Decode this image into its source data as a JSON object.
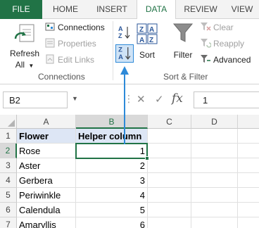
{
  "tabs": [
    "FILE",
    "HOME",
    "INSERT",
    "DATA",
    "REVIEW",
    "VIEW"
  ],
  "ribbon": {
    "connections_group": {
      "refresh_label": "Refresh",
      "refresh_sub": "All",
      "connections": "Connections",
      "properties": "Properties",
      "edit_links": "Edit Links",
      "group_label": "Connections"
    },
    "sort_filter_group": {
      "sort_label": "Sort",
      "filter_label": "Filter",
      "clear": "Clear",
      "reapply": "Reapply",
      "advanced": "Advanced",
      "group_label": "Sort & Filter"
    }
  },
  "formula_bar": {
    "name_box": "B2",
    "formula_value": "1"
  },
  "grid": {
    "columns": [
      "A",
      "B",
      "C",
      "D"
    ],
    "rows": [
      "1",
      "2",
      "3",
      "4",
      "5",
      "6",
      "7"
    ],
    "header": [
      "Flower",
      "Helper column"
    ],
    "data": [
      [
        "Rose",
        "1"
      ],
      [
        "Aster",
        "2"
      ],
      [
        "Gerbera",
        "3"
      ],
      [
        "Periwinkle",
        "4"
      ],
      [
        "Calendula",
        "5"
      ],
      [
        "Amaryllis",
        "6"
      ]
    ]
  },
  "colors": {
    "accent": "#217346",
    "annotation": "#2e8ad8"
  }
}
